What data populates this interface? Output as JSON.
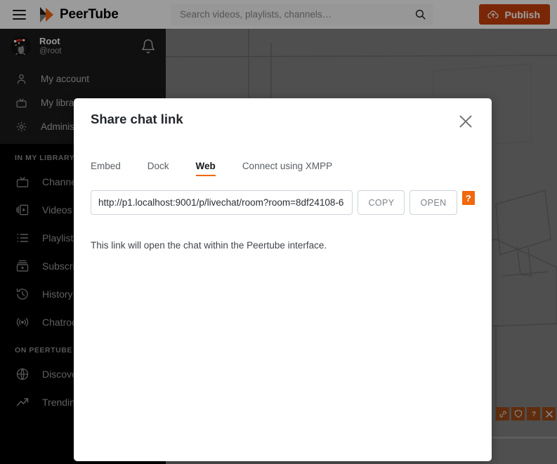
{
  "header": {
    "brand": "PeerTube",
    "menu_icon": "hamburger-icon",
    "logo_icon": "peertube-logo-icon",
    "search": {
      "placeholder": "Search videos, playlists, channels…",
      "value": "",
      "icon": "search-icon"
    },
    "publish": {
      "label": "Publish",
      "icon": "cloud-upload-icon",
      "color": "#c6400d"
    }
  },
  "sidebar": {
    "account": {
      "name": "Root",
      "handle": "@root",
      "avatar_icon": "penguin-avatar",
      "notification_icon": "bell-icon"
    },
    "top_items": [
      {
        "label": "My account",
        "icon": "person-icon"
      },
      {
        "label": "My library",
        "icon": "tv-icon"
      },
      {
        "label": "Administration",
        "icon": "gear-icon"
      }
    ],
    "sections": [
      {
        "title": "IN MY LIBRARY",
        "items": [
          {
            "label": "Channels",
            "icon": "tv-icon"
          },
          {
            "label": "Videos",
            "icon": "video-library-icon"
          },
          {
            "label": "Playlists",
            "icon": "list-icon"
          },
          {
            "label": "Subscriptions",
            "icon": "subscriptions-icon"
          },
          {
            "label": "History",
            "icon": "history-clock-icon"
          },
          {
            "label": "Chatrooms",
            "icon": "broadcast-icon"
          }
        ]
      },
      {
        "title": "ON PEERTUBE",
        "items": [
          {
            "label": "Discover",
            "icon": "globe-icon"
          },
          {
            "label": "Trending",
            "icon": "trending-up-icon"
          }
        ]
      }
    ]
  },
  "video": {
    "controls": [
      {
        "name": "link-icon"
      },
      {
        "name": "shield-icon"
      },
      {
        "name": "help-question-icon"
      },
      {
        "name": "close-x-icon"
      }
    ],
    "button_color": "#9c4a17"
  },
  "modal": {
    "title": "Share chat link",
    "close_icon": "close-icon",
    "tabs": [
      {
        "label": "Embed",
        "active": false
      },
      {
        "label": "Dock",
        "active": false
      },
      {
        "label": "Web",
        "active": true
      },
      {
        "label": "Connect using XMPP",
        "active": false
      }
    ],
    "active_tab_color": "#f1680d",
    "url_value": "http://p1.localhost:9001/p/livechat/room?room=8df24108-6",
    "copy_label": "COPY",
    "open_label": "OPEN",
    "help_badge": "?",
    "help_badge_color": "#f1680d",
    "note": "This link will open the chat within the Peertube interface."
  }
}
